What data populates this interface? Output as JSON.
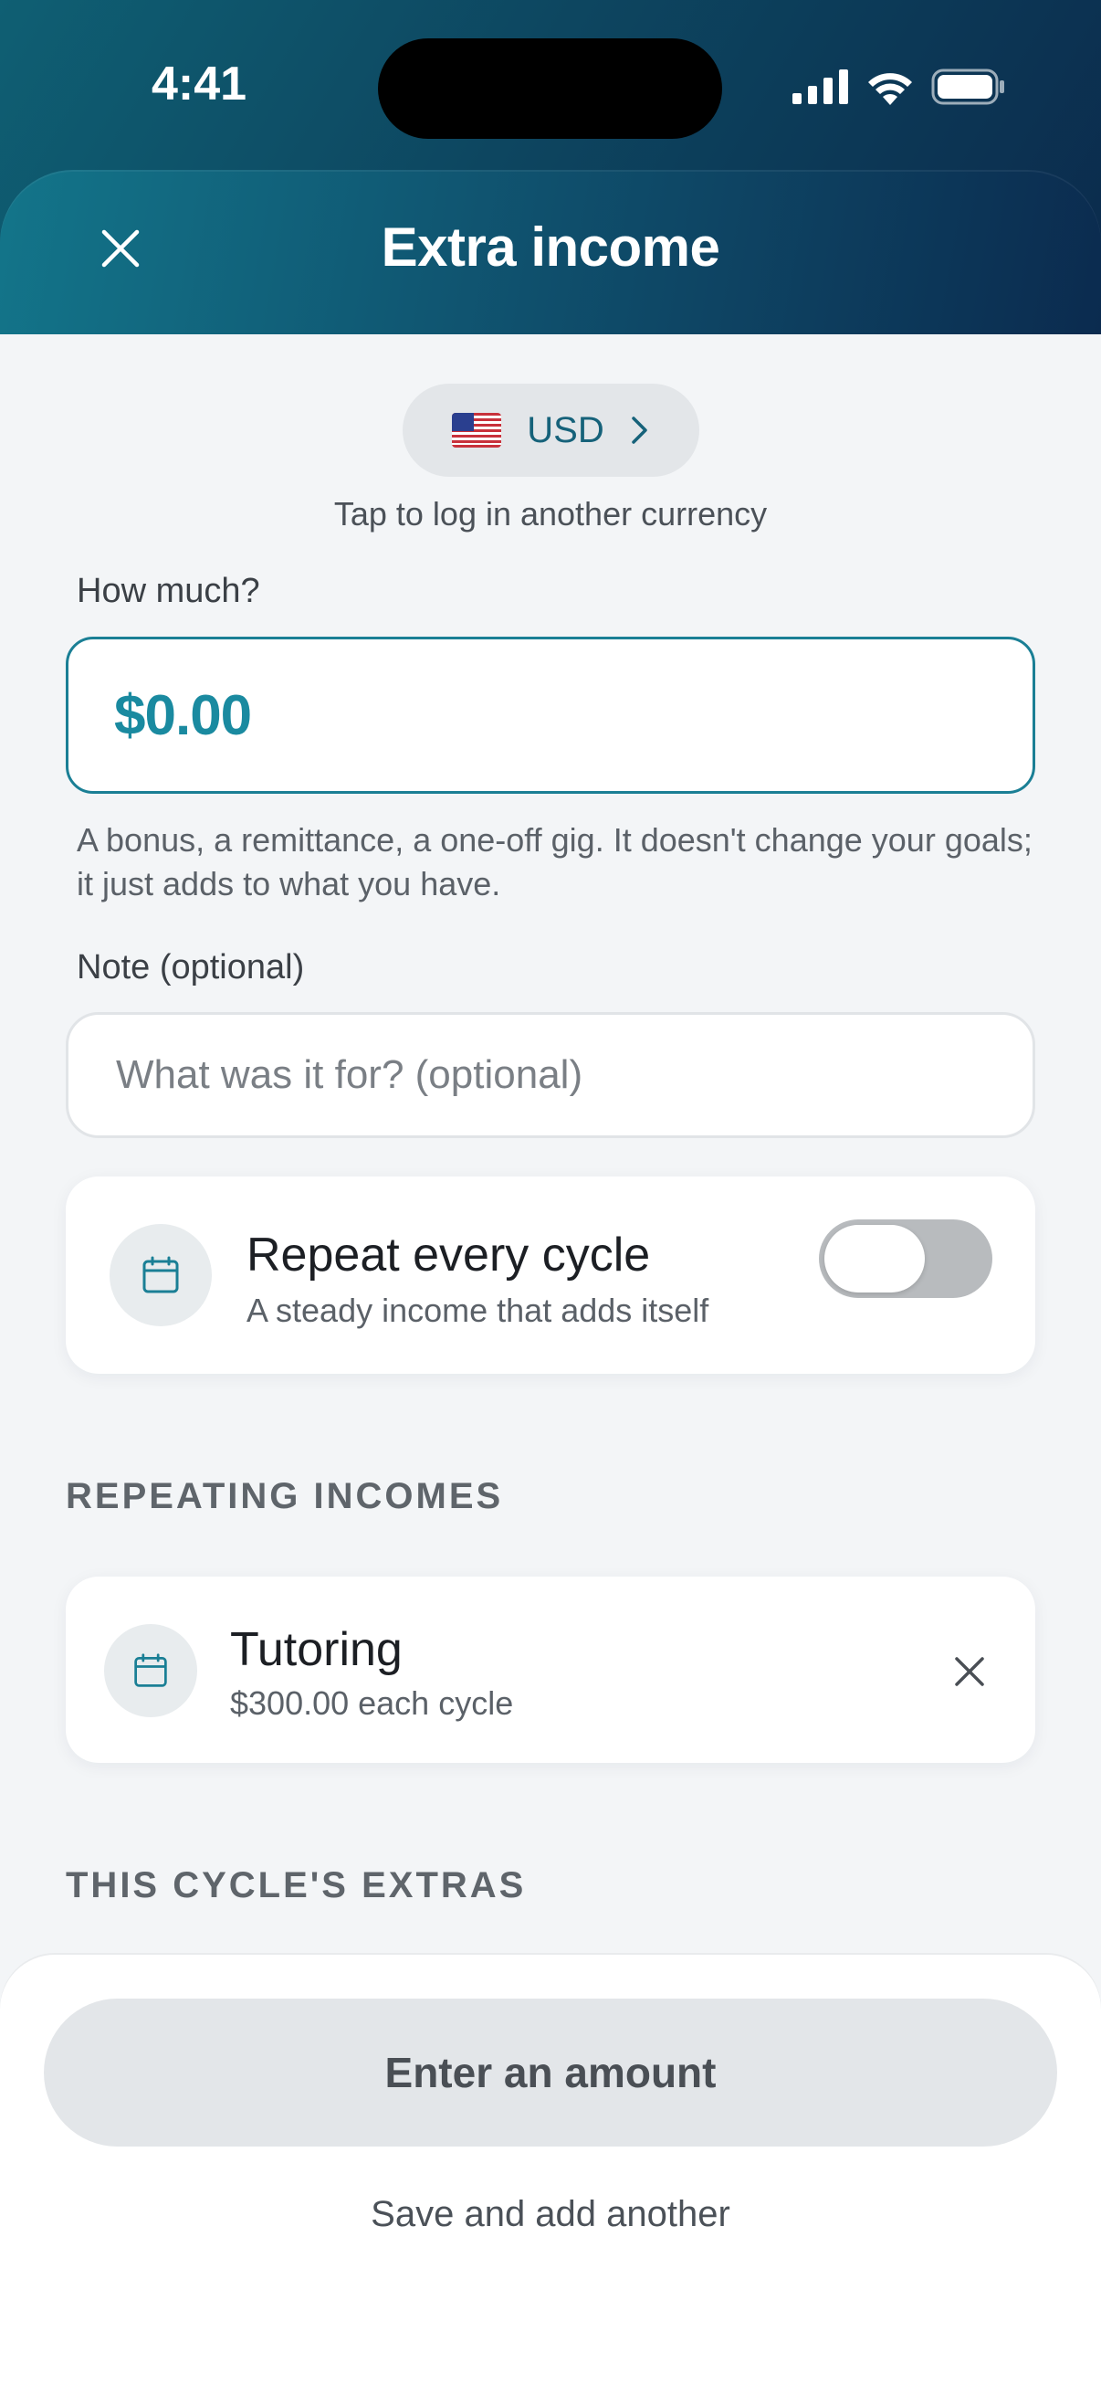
{
  "status_bar": {
    "time": "4:41"
  },
  "header": {
    "title": "Extra income"
  },
  "currency": {
    "flag": "us-flag",
    "code": "USD",
    "hint": "Tap to log in another currency"
  },
  "amount": {
    "label": "How much?",
    "value": "$0.00",
    "helper": "A bonus, a remittance, a one-off gig. It doesn't change your goals; it just adds to what you have."
  },
  "note": {
    "label": "Note (optional)",
    "placeholder": "What was it for? (optional)",
    "value": ""
  },
  "repeat": {
    "title": "Repeat every cycle",
    "subtitle": "A steady income that adds itself",
    "enabled": false
  },
  "repeating_section": {
    "title": "REPEATING INCOMES",
    "items": [
      {
        "name": "Tutoring",
        "detail": "$300.00 each cycle"
      }
    ]
  },
  "extras_section": {
    "title": "THIS CYCLE'S EXTRAS"
  },
  "footer": {
    "primary_label": "Enter an amount",
    "secondary_label": "Save and add another"
  },
  "colors": {
    "accent": "#1a8aa0",
    "header_dark": "#0b2a4c",
    "header_teal": "#13758a"
  }
}
